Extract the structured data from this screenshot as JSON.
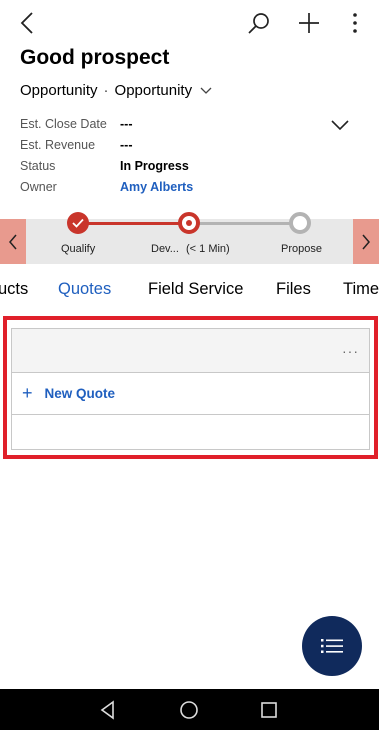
{
  "header": {
    "title": "Good prospect",
    "entity_type": "Opportunity",
    "form_name": "Opportunity"
  },
  "fields": [
    {
      "label": "Est. Close Date",
      "value": "---"
    },
    {
      "label": "Est. Revenue",
      "value": "---"
    },
    {
      "label": "Status",
      "value": "In Progress"
    },
    {
      "label": "Owner",
      "value": "Amy Alberts"
    }
  ],
  "process": {
    "stages": [
      {
        "label": "Qualify",
        "state": "complete"
      },
      {
        "label": "Dev...",
        "duration": "(< 1 Min)",
        "state": "active"
      },
      {
        "label": "Propose",
        "state": "pending"
      }
    ],
    "accent": "#c9352b"
  },
  "tabs": [
    "ucts",
    "Quotes",
    "Field Service",
    "Files",
    "Time"
  ],
  "active_tab": "Quotes",
  "quotes": {
    "more_label": "···",
    "new_label": "New Quote"
  },
  "colors": {
    "accent": "#1f5fbf",
    "highlight": "#e0202a",
    "fab": "#102a5c"
  }
}
